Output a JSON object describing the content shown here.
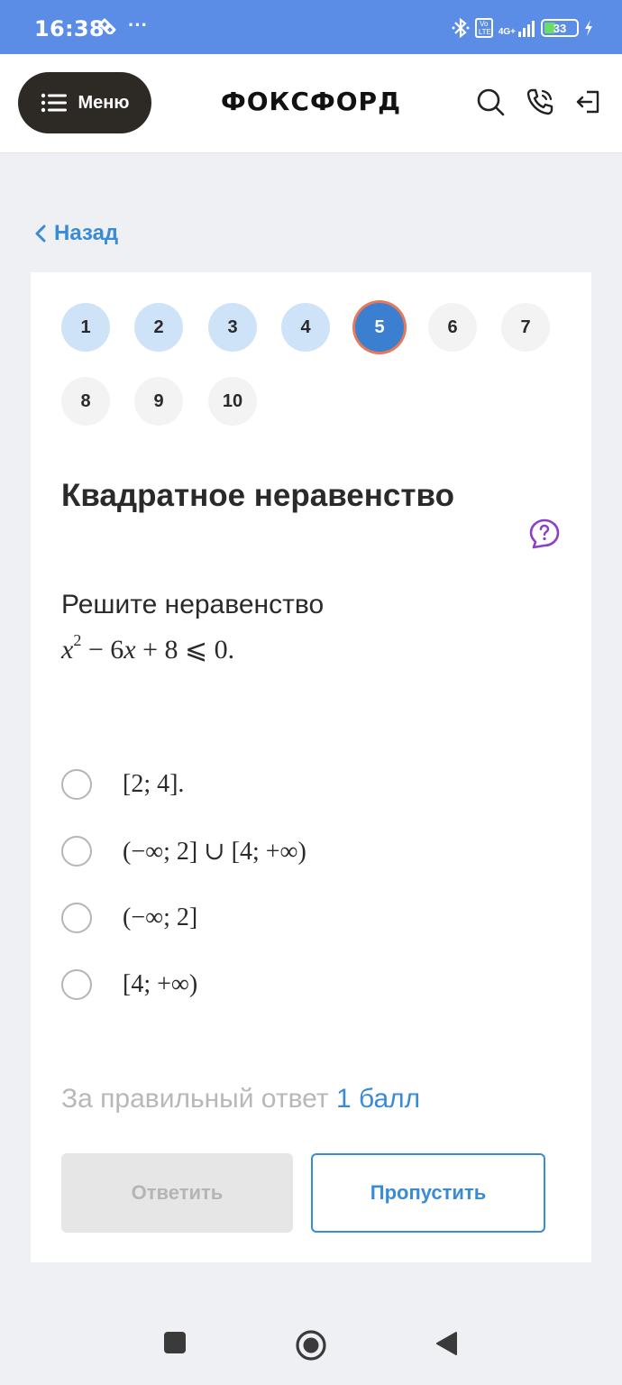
{
  "status_bar": {
    "time": "16:38",
    "dots": "···",
    "volte": "Vo LTE",
    "network": "4G+",
    "battery": "33",
    "icons": [
      "heartbeat-icon",
      "bluetooth-icon",
      "signal-icon",
      "battery-icon",
      "charging-icon"
    ]
  },
  "header": {
    "menu_label": "Меню",
    "logo": "ФОКСФОРД",
    "icons": [
      "search-icon",
      "phone-icon",
      "logout-icon"
    ]
  },
  "back": {
    "label": "Назад"
  },
  "steps": {
    "items": [
      {
        "label": "1",
        "state": "done"
      },
      {
        "label": "2",
        "state": "done"
      },
      {
        "label": "3",
        "state": "done"
      },
      {
        "label": "4",
        "state": "done"
      },
      {
        "label": "5",
        "state": "current"
      },
      {
        "label": "6",
        "state": "todo"
      },
      {
        "label": "7",
        "state": "todo"
      },
      {
        "label": "8",
        "state": "todo"
      },
      {
        "label": "9",
        "state": "todo"
      },
      {
        "label": "10",
        "state": "todo"
      }
    ]
  },
  "question": {
    "title": "Квадратное неравенство",
    "text": "Решите неравенство",
    "formula": {
      "var": "x",
      "exp": "2",
      "rest": " − 6",
      "var2": "x",
      "tail": " + 8 ⩽ 0."
    },
    "options": [
      {
        "label": "[2; 4]."
      },
      {
        "label": "(−∞; 2] ∪ [4; +∞)"
      },
      {
        "label": "(−∞; 2]"
      },
      {
        "label": "[4; +∞)"
      }
    ]
  },
  "scoring": {
    "prefix": "За правильный ответ",
    "points": "1 балл"
  },
  "actions": {
    "submit_label": "Ответить",
    "skip_label": "Пропустить"
  },
  "colors": {
    "accent": "#3a8bd6",
    "current_step": "#3a7fd0",
    "current_ring": "#e8785a",
    "done_step": "#cfe3f8",
    "help_icon": "#8a3fc9",
    "status_bar": "#5b8de6"
  }
}
